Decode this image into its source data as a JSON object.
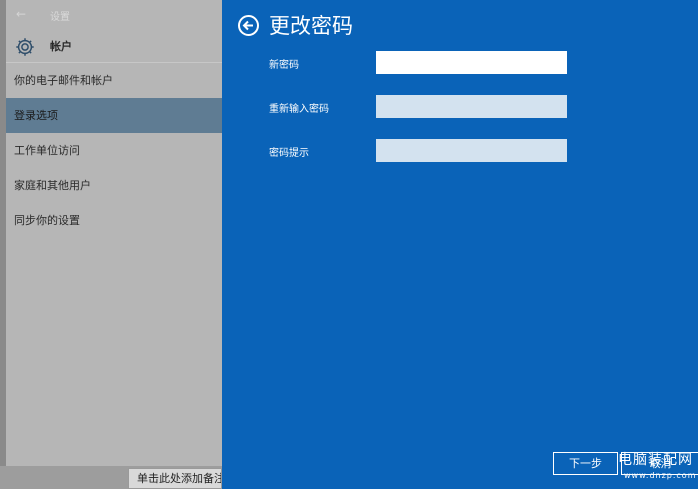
{
  "settings": {
    "title": "设置",
    "back_glyph": "←",
    "header_title": "帐户",
    "nav_items": [
      {
        "label": "你的电子邮件和帐户",
        "selected": false
      },
      {
        "label": "登录选项",
        "selected": true
      },
      {
        "label": "工作单位访问",
        "selected": false
      },
      {
        "label": "家庭和其他用户",
        "selected": false
      },
      {
        "label": "同步你的设置",
        "selected": false
      }
    ]
  },
  "taskbar": {
    "button_label": "单击此处添加备注"
  },
  "dialog": {
    "title": "更改密码",
    "fields": [
      {
        "label": "新密码",
        "value": "",
        "placeholder": ""
      },
      {
        "label": "重新输入密码",
        "value": "",
        "placeholder": ""
      },
      {
        "label": "密码提示",
        "value": "",
        "placeholder": ""
      }
    ],
    "next_label": "下一步",
    "cancel_label": "取消"
  },
  "watermark": {
    "main": "电脑装配网",
    "sub": "www.dnzp.com"
  },
  "colors": {
    "dialog_bg": "#0a63b8",
    "selected_nav": "#5f7c93"
  }
}
